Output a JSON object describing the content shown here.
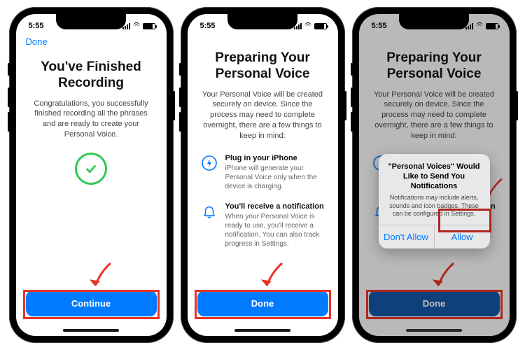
{
  "status_bar": {
    "time": "5:55"
  },
  "colors": {
    "accent": "#007aff",
    "success": "#34c759",
    "highlight": "#e93226"
  },
  "screen1": {
    "nav_done": "Done",
    "title": "You've Finished Recording",
    "body": "Congratulations, you successfully finished recording all the phrases and are ready to create your Personal Voice.",
    "button": "Continue"
  },
  "screen2": {
    "title": "Preparing Your Personal Voice",
    "body": "Your Personal Voice will be created securely on device. Since the process may need to complete overnight, there are a few things to keep in mind:",
    "items": [
      {
        "icon": "bolt-circle-icon",
        "heading": "Plug in your iPhone",
        "text": "iPhone will generate your Personal Voice only when the device is charging."
      },
      {
        "icon": "bell-icon",
        "heading": "You'll receive a notification",
        "text": "When your Personal Voice is ready to use, you'll receive a notification. You can also track progress in Settings."
      }
    ],
    "button": "Done"
  },
  "screen3": {
    "title": "Preparing Your Personal Voice",
    "body": "Your Personal Voice will be created securely on device. Since the process may need to complete overnight, there are a few things to keep in mind:",
    "button": "Done",
    "alert": {
      "title": "\"Personal Voices\" Would Like to Send You Notifications",
      "message": "Notifications may include alerts, sounds and icon badges. These can be configured in Settings.",
      "deny": "Don't Allow",
      "allow": "Allow"
    }
  }
}
